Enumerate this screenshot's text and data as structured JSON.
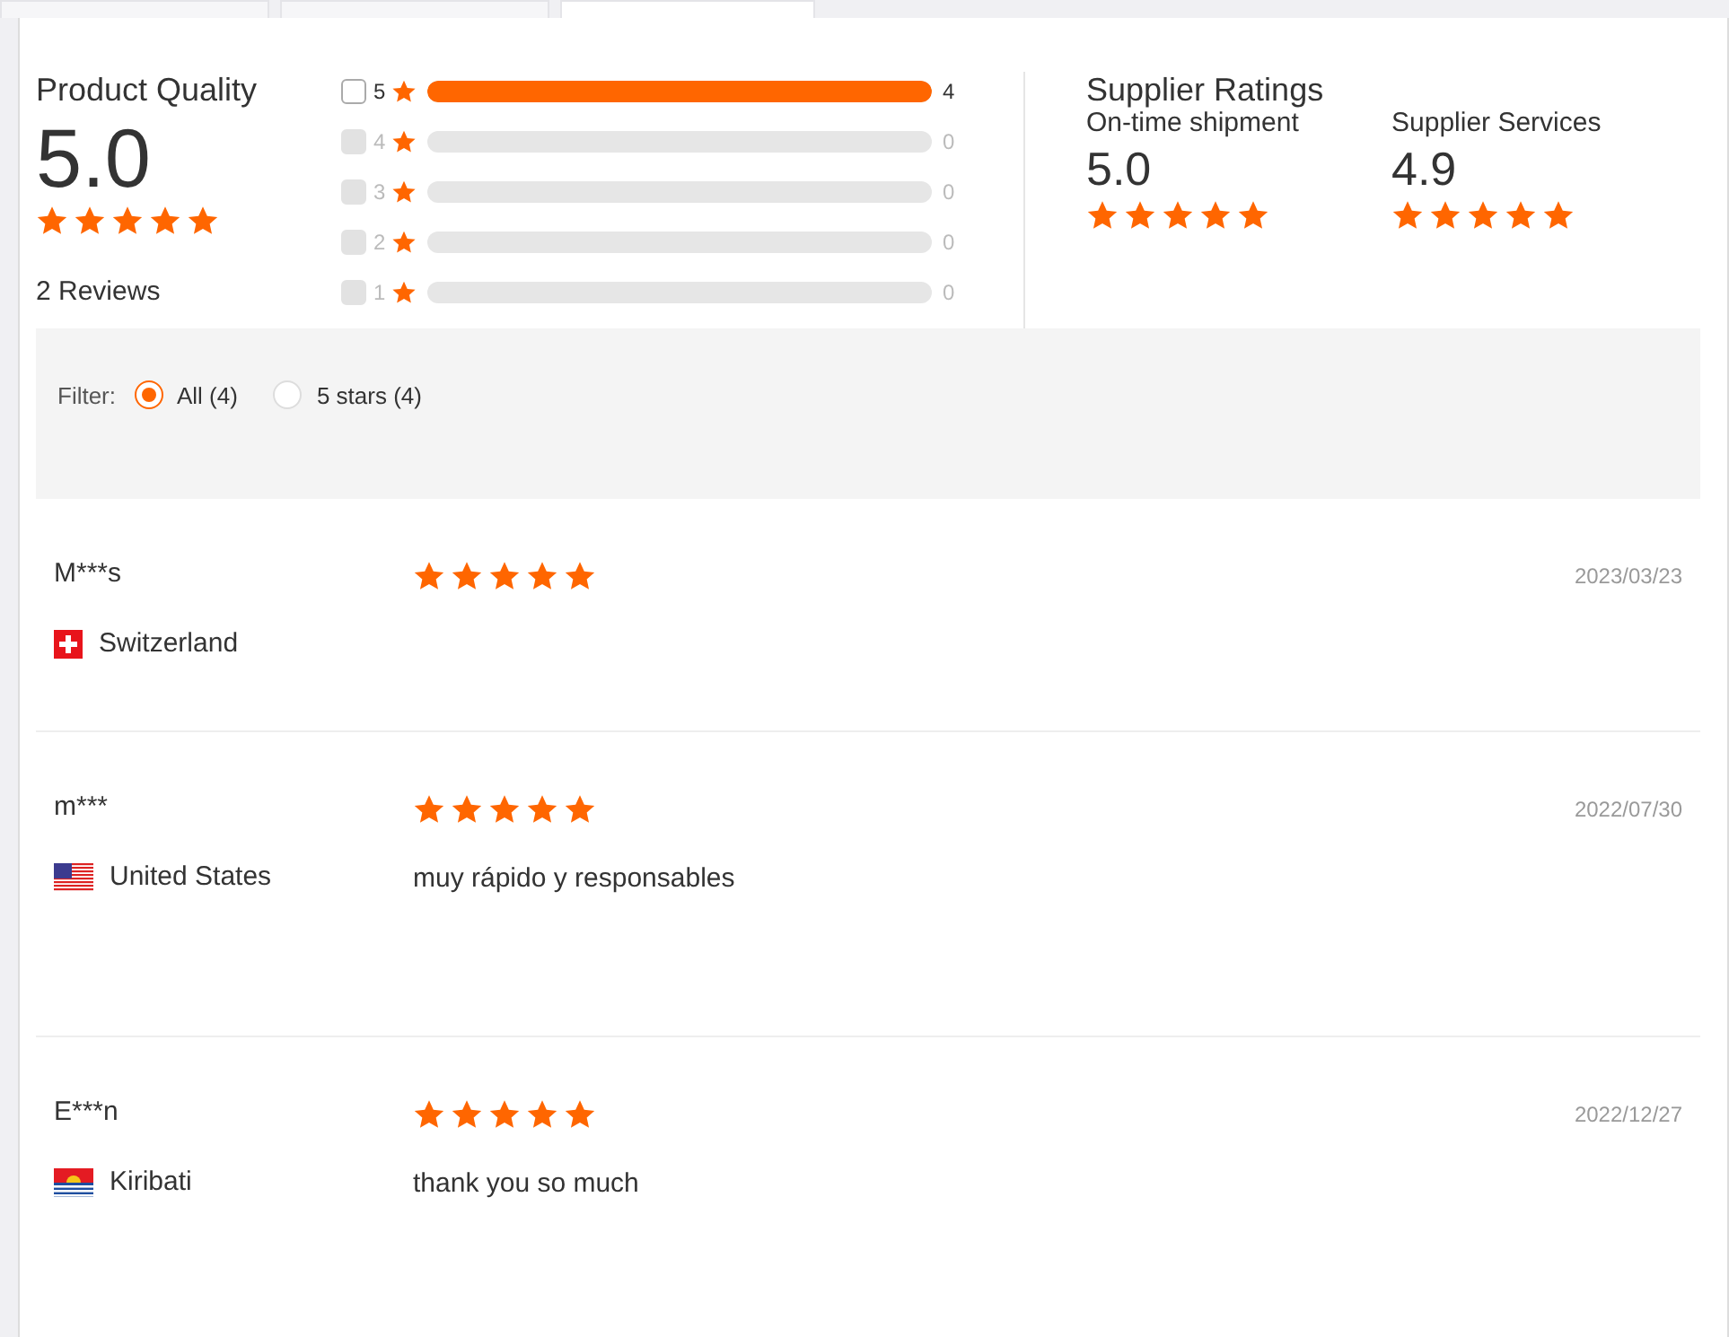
{
  "tabs": [
    {
      "selected": false
    },
    {
      "selected": false
    },
    {
      "selected": true
    }
  ],
  "product_quality": {
    "title": "Product Quality",
    "score": "5.0",
    "stars": 5,
    "reviews": "2 Reviews"
  },
  "breakdown": [
    {
      "star": "5",
      "level": 1,
      "count": "4",
      "disabled": false
    },
    {
      "star": "4",
      "level": 0,
      "count": "0",
      "disabled": true
    },
    {
      "star": "3",
      "level": 0,
      "count": "0",
      "disabled": true
    },
    {
      "star": "2",
      "level": 0,
      "count": "0",
      "disabled": true
    },
    {
      "star": "1",
      "level": 0,
      "count": "0",
      "disabled": true
    }
  ],
  "supplier_ratings": {
    "title": "Supplier Ratings",
    "items": [
      {
        "label": "On-time shipment",
        "score": "5.0",
        "stars": 5
      },
      {
        "label": "Supplier Services",
        "score": "4.9",
        "stars": 5
      }
    ]
  },
  "filter": {
    "label": "Filter:",
    "options": [
      {
        "label": "All (4)",
        "selected": true
      },
      {
        "label": "5 stars (4)",
        "selected": false
      }
    ]
  },
  "reviews": [
    {
      "name": "M***s",
      "country": "Switzerland",
      "kind": "switzerland",
      "stars": 5,
      "date": "2023/03/23"
    },
    {
      "name": "m***",
      "country": "United States",
      "kind": "usa",
      "stars": 5,
      "date": "2022/07/30",
      "comment": "muy rápido y responsables"
    },
    {
      "name": "E***n",
      "country": "Kiribati",
      "kind": "kiribati",
      "stars": 5,
      "date": "2022/12/27",
      "comment": "thank you so much"
    }
  ]
}
